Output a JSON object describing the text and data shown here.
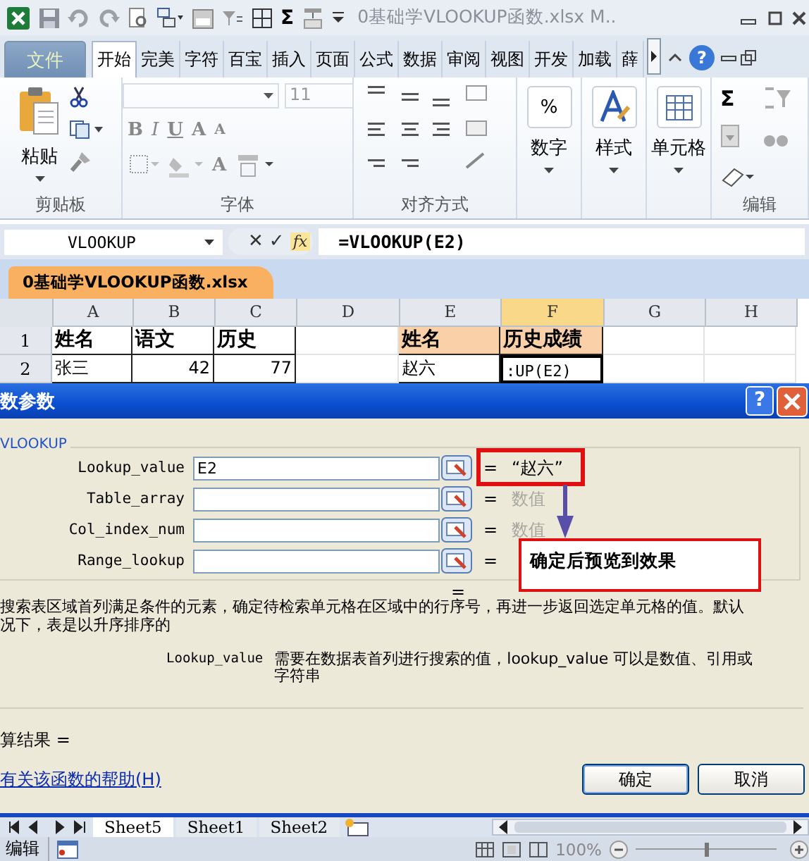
{
  "title_bar": {
    "title": "0基础学VLOOKUP函数.xlsx M..",
    "sum": "Σ"
  },
  "ribbon_tabs": [
    {
      "label": "文件",
      "kind": "file",
      "selected": false
    },
    {
      "label": "开始",
      "kind": "tab",
      "selected": true
    },
    {
      "label": "完美",
      "kind": "tab",
      "selected": false
    },
    {
      "label": "字符",
      "kind": "tab",
      "selected": false
    },
    {
      "label": "百宝",
      "kind": "tab",
      "selected": false
    },
    {
      "label": "插入",
      "kind": "tab",
      "selected": false
    },
    {
      "label": "页面",
      "kind": "tab",
      "selected": false
    },
    {
      "label": "公式",
      "kind": "tab",
      "selected": false
    },
    {
      "label": "数据",
      "kind": "tab",
      "selected": false
    },
    {
      "label": "审阅",
      "kind": "tab",
      "selected": false
    },
    {
      "label": "视图",
      "kind": "tab",
      "selected": false
    },
    {
      "label": "开发",
      "kind": "tab",
      "selected": false
    },
    {
      "label": "加载",
      "kind": "tab",
      "selected": false
    },
    {
      "label": "薛",
      "kind": "tab",
      "selected": false
    }
  ],
  "help": "?",
  "ribbon_groups": [
    {
      "kind": "clipboard",
      "label": "剪贴板",
      "button": "粘贴"
    },
    {
      "kind": "font",
      "label": "字体",
      "font_size": "11",
      "font_buttons": [
        "B",
        "I",
        "U",
        "A",
        "A"
      ],
      "font_color": "A"
    },
    {
      "kind": "align",
      "label": "对齐方式"
    },
    {
      "kind": "big",
      "button": "数字",
      "icon_text": "%"
    },
    {
      "kind": "big",
      "button": "样式"
    },
    {
      "kind": "big",
      "button": "单元格"
    },
    {
      "kind": "edit",
      "label": "编辑",
      "sum": "Σ"
    }
  ],
  "formula_bar": {
    "name_box": "VLOOKUP",
    "cancel": "✕",
    "enter": "✓",
    "fx": "fx",
    "formula": "=VLOOKUP(E2)"
  },
  "workbook_tab": {
    "label": "0基础学VLOOKUP函数.xlsx"
  },
  "sheet": {
    "columns": [
      {
        "label": "A",
        "selected": false
      },
      {
        "label": "B",
        "selected": false
      },
      {
        "label": "C",
        "selected": false
      },
      {
        "label": "D",
        "selected": false
      },
      {
        "label": "E",
        "selected": false
      },
      {
        "label": "F",
        "selected": true
      },
      {
        "label": "G",
        "selected": false
      },
      {
        "label": "H",
        "selected": false
      }
    ],
    "rows": [
      {
        "label": "1",
        "cells": [
          {
            "text": "姓名",
            "bold": true
          },
          {
            "text": "语文",
            "bold": true
          },
          {
            "text": "历史",
            "bold": true
          },
          null,
          {
            "text": "姓名",
            "bold": true,
            "highlighted": true
          },
          {
            "text": "历史成绩",
            "bold": true,
            "highlighted": true
          },
          null,
          null
        ]
      },
      {
        "label": "2",
        "cells": [
          {
            "text": "张三"
          },
          {
            "text": "42",
            "kind": "number"
          },
          {
            "text": "77",
            "kind": "number"
          },
          null,
          {
            "text": "赵六"
          },
          {
            "text": ":UP(E2)",
            "active": true
          },
          null,
          null
        ]
      }
    ]
  },
  "dialog": {
    "title": "数参数",
    "function_name": "VLOOKUP",
    "args": [
      {
        "name": "Lookup_value",
        "value": "E2",
        "eq": "=",
        "result": "“赵六”",
        "greyed": false
      },
      {
        "name": "Table_array",
        "eq": "=",
        "result": "数值",
        "greyed": true
      },
      {
        "name": "Col_index_num",
        "eq": "=",
        "result": "数值",
        "greyed": true
      },
      {
        "name": "Range_lookup",
        "eq": "="
      }
    ],
    "overall": "=",
    "description": [
      "搜索表区域首列满足条件的元素，确定待检索单元格在区域中的行序号，再进一步返回选定单元格的值。默认",
      "况下，表是以升序排序的"
    ],
    "arg_help": {
      "name": "Lookup_value",
      "text": "需要在数据表首列进行搜索的值，lookup_value 可以是数值、引用或字符串"
    },
    "calc_result": "算结果 =",
    "help_link": "有关该函数的帮助(H)",
    "buttons": [
      "确定",
      "取消"
    ]
  },
  "annotation": {
    "text": "确定后预览到效果"
  },
  "sheet_tabs": [
    {
      "label": "Sheet5",
      "selected": true
    },
    {
      "label": "Sheet1",
      "selected": false
    },
    {
      "label": "Sheet2",
      "selected": false
    }
  ],
  "status_bar": {
    "mode": "编辑",
    "zoom": "100%",
    "zoom_level": {
      "level": 0.5
    }
  }
}
